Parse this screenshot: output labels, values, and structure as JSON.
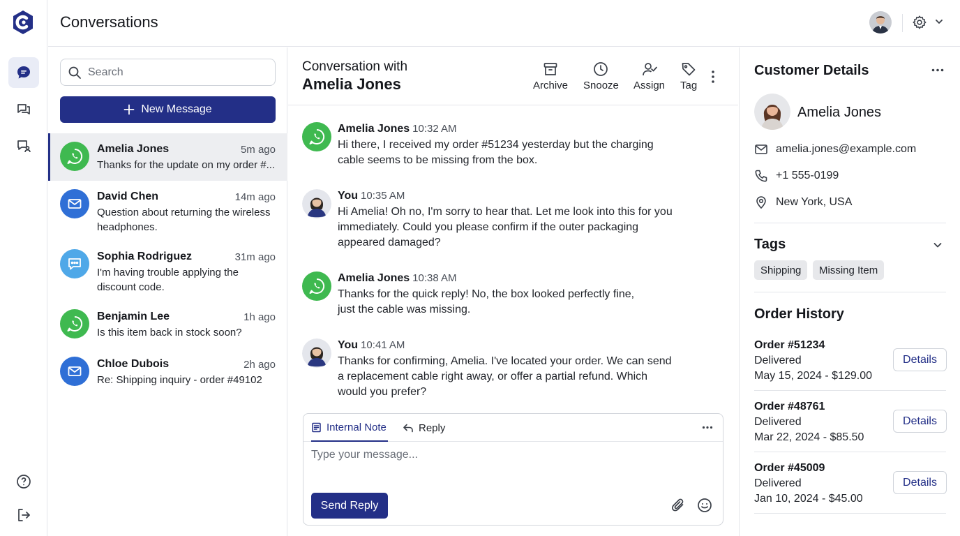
{
  "app": {
    "title": "Conversations",
    "colors": {
      "accent": "#232f87",
      "whatsapp": "#3fb950",
      "email": "#2f6fd6",
      "chat": "#4fa8e8"
    }
  },
  "rail": {
    "items": [
      {
        "name": "chat-bubble-icon",
        "active": true
      },
      {
        "name": "messages-icon",
        "active": false
      },
      {
        "name": "contacts-chat-icon",
        "active": false
      }
    ],
    "bottom": [
      "help-icon",
      "logout-icon"
    ]
  },
  "topbar": {
    "avatar_icon": "user-avatar",
    "settings_icon": "gear-icon"
  },
  "search": {
    "placeholder": "Search"
  },
  "new_message": {
    "label": "New Message"
  },
  "conversations": [
    {
      "name": "Amelia Jones",
      "time": "5m ago",
      "preview": "Thanks for the update on my order #...",
      "channel": "whatsapp"
    },
    {
      "name": "David Chen",
      "time": "14m ago",
      "preview": "Question about returning the wireless headphones.",
      "channel": "email"
    },
    {
      "name": "Sophia Rodriguez",
      "time": "31m ago",
      "preview": "I'm having trouble applying the discount code.",
      "channel": "chat"
    },
    {
      "name": "Benjamin Lee",
      "time": "1h ago",
      "preview": "Is this item back in stock soon?",
      "channel": "whatsapp"
    },
    {
      "name": "Chloe Dubois",
      "time": "2h ago",
      "preview": "Re: Shipping inquiry - order #49102",
      "channel": "email"
    }
  ],
  "thread": {
    "heading_line1": "Conversation with",
    "heading_line2": "Amelia Jones",
    "actions": [
      {
        "label": "Archive",
        "icon": "archive-icon"
      },
      {
        "label": "Snooze",
        "icon": "clock-icon"
      },
      {
        "label": "Assign",
        "icon": "assign-user-icon"
      },
      {
        "label": "Tag",
        "icon": "tag-icon"
      }
    ],
    "messages": [
      {
        "sender": "Amelia Jones",
        "time": "10:32 AM",
        "text": "Hi there, I received my order #51234 yesterday but the charging cable seems to be missing from the box."
      },
      {
        "sender": "You",
        "time": "10:35 AM",
        "text": "Hi Amelia! Oh no, I'm sorry to hear that. Let me look into this for you immediately. Could you please confirm if the outer packaging appeared damaged?"
      },
      {
        "sender": "Amelia Jones",
        "time": "10:38 AM",
        "text": "Thanks for the quick reply! No, the box looked perfectly fine, just the cable was missing."
      },
      {
        "sender": "You",
        "time": "10:41 AM",
        "text": "Thanks for confirming, Amelia. I've located your order. We can send a replacement cable right away, or offer a partial refund. Which would you prefer?"
      }
    ],
    "composer": {
      "tab_note": "Internal Note",
      "tab_reply": "Reply",
      "placeholder": "Type your message...",
      "send_label": "Send Reply"
    }
  },
  "customer": {
    "heading": "Customer Details",
    "name": "Amelia Jones",
    "email": "amelia.jones@example.com",
    "phone": "+1 555-0199",
    "location": "New York, USA",
    "tags_heading": "Tags",
    "tags": [
      "Shipping",
      "Missing Item"
    ],
    "orders_heading": "Order History",
    "orders": [
      {
        "title": "Order #51234",
        "status": "Delivered",
        "date": "May 15, 2024 - $129.00",
        "button": "Details"
      },
      {
        "title": "Order #48761",
        "status": "Delivered",
        "date": "Mar 22, 2024 - $85.50",
        "button": "Details"
      },
      {
        "title": "Order #45009",
        "status": "Delivered",
        "date": "Jan 10, 2024 - $45.00",
        "button": "Details"
      }
    ]
  }
}
